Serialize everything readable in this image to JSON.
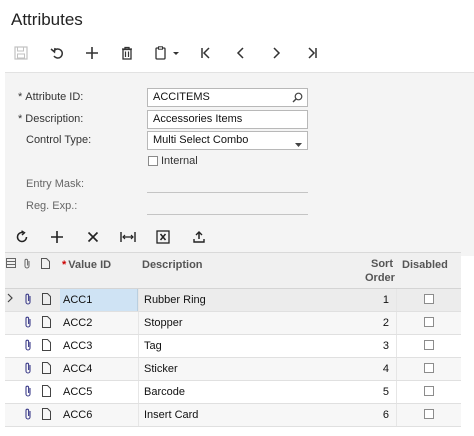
{
  "page": {
    "title": "Attributes"
  },
  "toolbar": {
    "icons": [
      "save-icon",
      "undo-icon",
      "add-icon",
      "delete-icon",
      "copy-paste-icon",
      "first-record-icon",
      "previous-record-icon",
      "next-record-icon",
      "last-record-icon"
    ]
  },
  "form": {
    "attribute_id": {
      "label": "Attribute ID:",
      "value": "ACCITEMS",
      "required": "*"
    },
    "description": {
      "label": "Description:",
      "value": "Accessories Items",
      "required": "*"
    },
    "control_type": {
      "label": "Control Type:",
      "value": "Multi Select Combo"
    },
    "internal": {
      "label": "Internal",
      "checked": false
    },
    "entry_mask": {
      "label": "Entry Mask:",
      "value": ""
    },
    "reg_exp": {
      "label": "Reg. Exp.:",
      "value": ""
    }
  },
  "grid_toolbar": {
    "icons": [
      "refresh-icon",
      "add-row-icon",
      "delete-row-icon",
      "fit-columns-icon",
      "export-excel-icon",
      "upload-icon"
    ]
  },
  "grid": {
    "columns": {
      "value_id": "Value ID",
      "value_id_required": "*",
      "description": "Description",
      "sort_order_line1": "Sort",
      "sort_order_line2": "Order",
      "disabled": "Disabled"
    },
    "rows": [
      {
        "value_id": "ACC1",
        "description": "Rubber Ring",
        "sort_order": "1",
        "disabled": false
      },
      {
        "value_id": "ACC2",
        "description": "Stopper",
        "sort_order": "2",
        "disabled": false
      },
      {
        "value_id": "ACC3",
        "description": "Tag",
        "sort_order": "3",
        "disabled": false
      },
      {
        "value_id": "ACC4",
        "description": "Sticker",
        "sort_order": "4",
        "disabled": false
      },
      {
        "value_id": "ACC5",
        "description": "Barcode",
        "sort_order": "5",
        "disabled": false
      },
      {
        "value_id": "ACC6",
        "description": "Insert Card",
        "sort_order": "6",
        "disabled": false
      }
    ]
  }
}
